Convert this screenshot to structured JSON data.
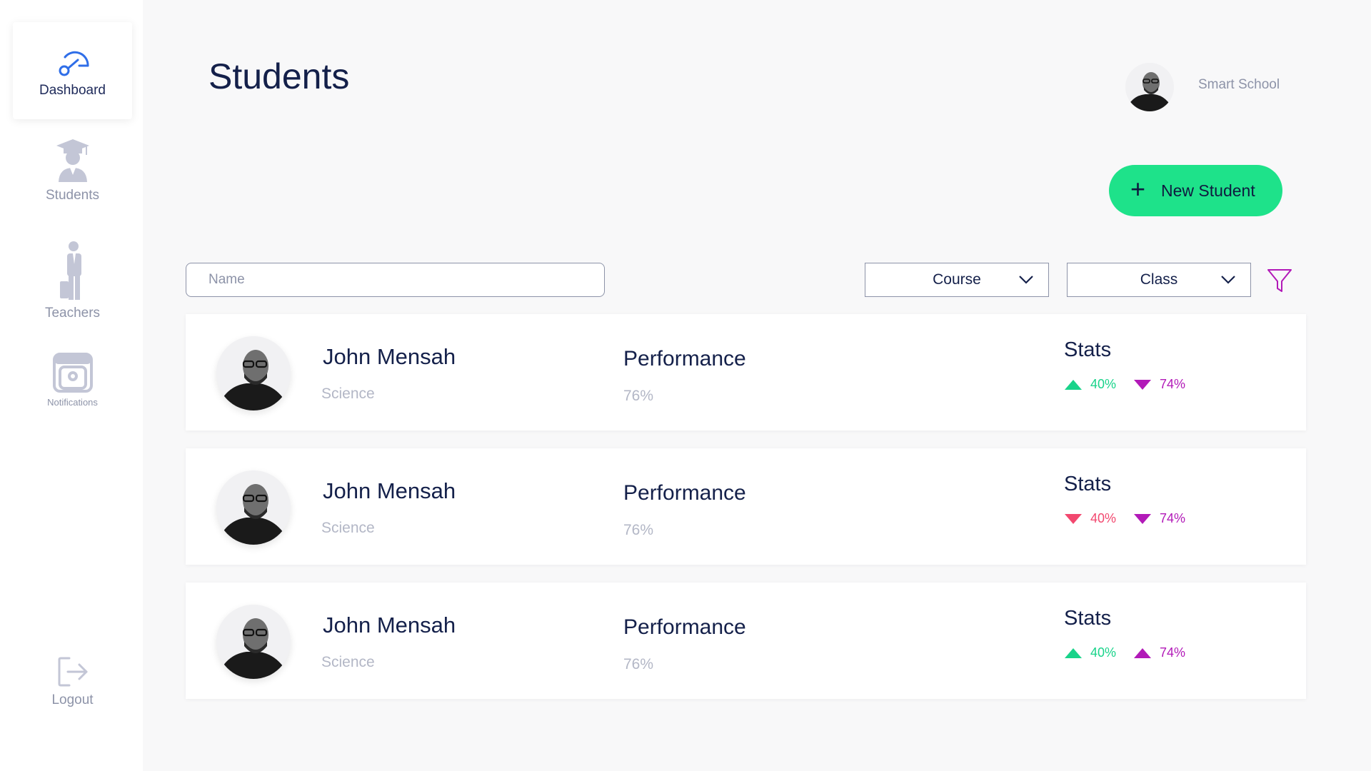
{
  "sidebar": {
    "items": [
      {
        "label": "Dashboard",
        "icon": "dashboard-gauge-icon"
      },
      {
        "label": "Students",
        "icon": "graduate-student-icon"
      },
      {
        "label": "Teachers",
        "icon": "teacher-icon"
      },
      {
        "label": "Notifications",
        "icon": "notification-icon"
      }
    ],
    "logout": {
      "label": "Logout",
      "icon": "logout-icon"
    }
  },
  "header": {
    "title": "Students",
    "school_name": "Smart School"
  },
  "actions": {
    "new_student_label": "New Student"
  },
  "filters": {
    "name_placeholder": "Name",
    "course_label": "Course",
    "class_label": "Class"
  },
  "colors": {
    "accent_green": "#1ee28a",
    "up_green": "#19d38a",
    "down_pink": "#f2486f",
    "magenta": "#b21ab8",
    "navy": "#14204a",
    "muted": "#8d93a8",
    "active_blue": "#2f6ee8"
  },
  "students": [
    {
      "name": "John Mensah",
      "course": "Science",
      "performance_label": "Performance",
      "performance_value": "76%",
      "stats_label": "Stats",
      "stats": [
        {
          "value": "40%",
          "direction": "up",
          "color": "#19d38a"
        },
        {
          "value": "74%",
          "direction": "down",
          "color": "#b21ab8"
        }
      ]
    },
    {
      "name": "John Mensah",
      "course": "Science",
      "performance_label": "Performance",
      "performance_value": "76%",
      "stats_label": "Stats",
      "stats": [
        {
          "value": "40%",
          "direction": "down",
          "color": "#f2486f"
        },
        {
          "value": "74%",
          "direction": "down",
          "color": "#b21ab8"
        }
      ]
    },
    {
      "name": "John Mensah",
      "course": "Science",
      "performance_label": "Performance",
      "performance_value": "76%",
      "stats_label": "Stats",
      "stats": [
        {
          "value": "40%",
          "direction": "up",
          "color": "#19d38a"
        },
        {
          "value": "74%",
          "direction": "up",
          "color": "#b21ab8"
        }
      ]
    }
  ]
}
